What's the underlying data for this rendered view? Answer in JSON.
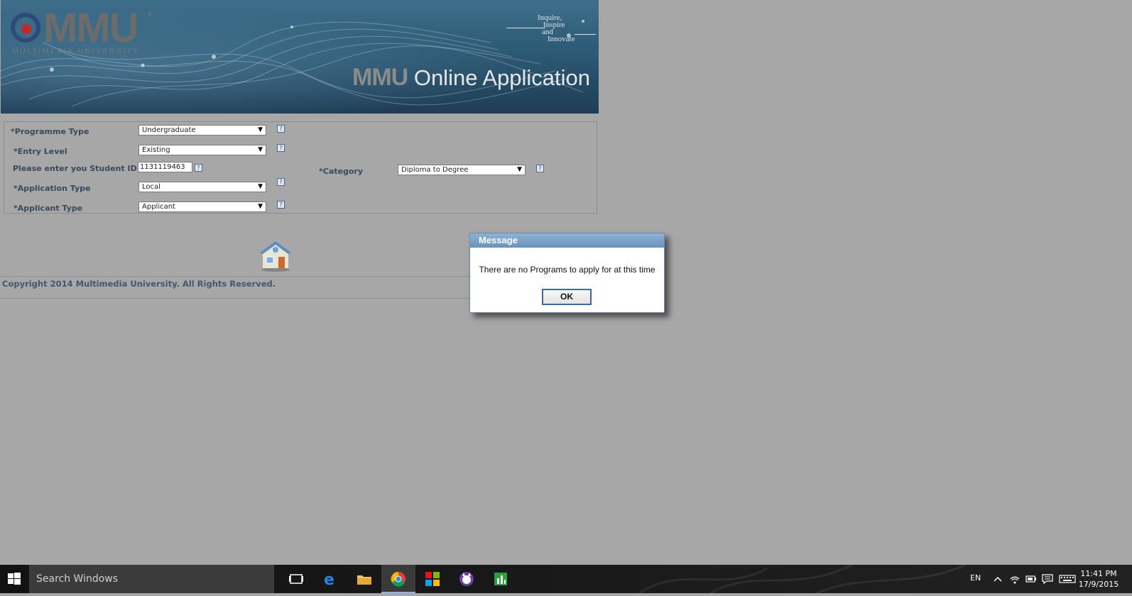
{
  "header": {
    "logo_word": "MMU",
    "logo_sub": "MULTIMEDIA UNIVERSITY",
    "logo_reg": "®",
    "tagline": [
      "Inquire,",
      "Inspire",
      "and",
      "Innovate"
    ],
    "title_bold": "MMU",
    "title_rest": " Online Application"
  },
  "form": {
    "programme_type": {
      "label": "*Programme Type",
      "value": "Undergraduate"
    },
    "entry_level": {
      "label": "*Entry Level",
      "value": "Existing"
    },
    "student_id": {
      "label": "Please enter you Student ID",
      "value": "1131119463"
    },
    "application_type": {
      "label": "*Application Type",
      "value": "Local"
    },
    "applicant_type": {
      "label": "*Applicant Type",
      "value": "Applicant"
    },
    "category": {
      "label": "*Category",
      "value": "Diploma to Degree"
    },
    "help_glyph": "?",
    "dropdown_glyph": "▼"
  },
  "footer": {
    "copyright": "Copyright 2014 Multimedia University. All Rights Reserved."
  },
  "dialog": {
    "title": "Message",
    "message": "There are no Programs to apply for at this time",
    "ok_label": "OK"
  },
  "taskbar": {
    "search_placeholder": "Search Windows",
    "language": "EN",
    "time": "11:41 PM",
    "date": "17/9/2015",
    "icons": [
      "windows-start-icon",
      "task-view-icon",
      "edge-icon",
      "file-explorer-icon",
      "chrome-icon",
      "store-icon",
      "cat-app-icon",
      "project-app-icon"
    ]
  },
  "colors": {
    "page_background": "#a7a7a7",
    "banner_blue": "#2d5a75",
    "dialog_title": "#7aa0c8",
    "ok_border": "#3d6aa8"
  }
}
